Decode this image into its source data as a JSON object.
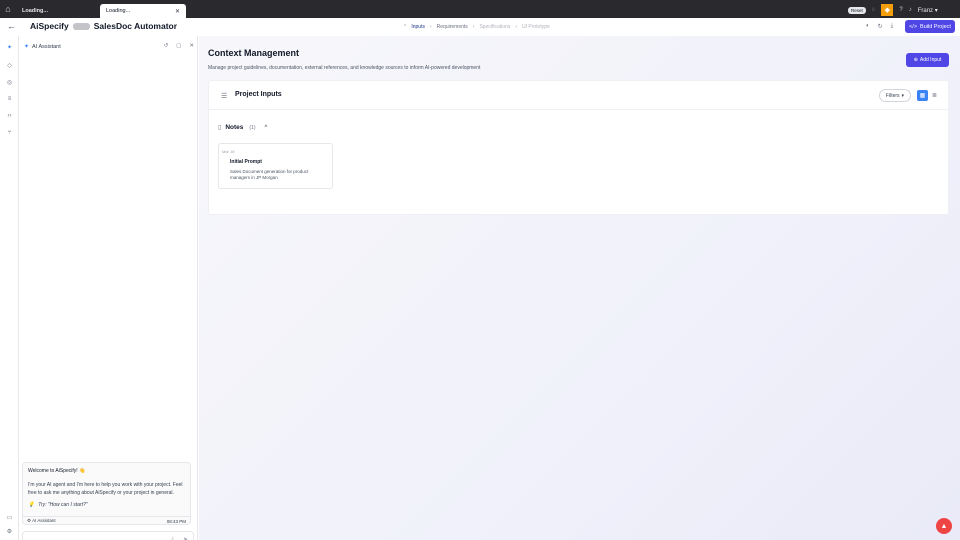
{
  "browser": {
    "tab1_label": "Loading...",
    "tab2_label": "Loading...",
    "reset_label": "Reset",
    "user_name": "Franz"
  },
  "header": {
    "brand": "AiSpecify",
    "project_name": "SalesDoc Automator",
    "build_label": "Build Project"
  },
  "stepper": {
    "steps": [
      "Inputs",
      "Requirements",
      "Specifications",
      "UI Prototype"
    ]
  },
  "assistant": {
    "title": "AI Assistant",
    "welcome_title": "Welcome to AiSpecify! 👋",
    "welcome_body": "I'm your AI agent and I'm here to help you work with your project. Feel free to ask me anything about AiSpecify or your project in general.",
    "try_text": "Try: \"How can I start?\"",
    "footer_label": "AI Assistant",
    "footer_time": "08:43 PM",
    "input_placeholder": ""
  },
  "main": {
    "title": "Context Management",
    "subtitle": "Manage project guidelines, documentation, external references, and knowledge sources to inform AI-powered development",
    "add_input_label": "Add Input",
    "panel_title": "Project Inputs",
    "filters_label": "Filters",
    "notes_label": "Notes",
    "notes_count": "(1)",
    "note": {
      "date": "Mar 18",
      "title": "Initial Prompt",
      "body": "Sales Document generation for product managers in JP Morgan"
    }
  },
  "colors": {
    "accent": "#4f46e5",
    "active_toggle": "#3b82f6",
    "widget": "#ef4444"
  }
}
